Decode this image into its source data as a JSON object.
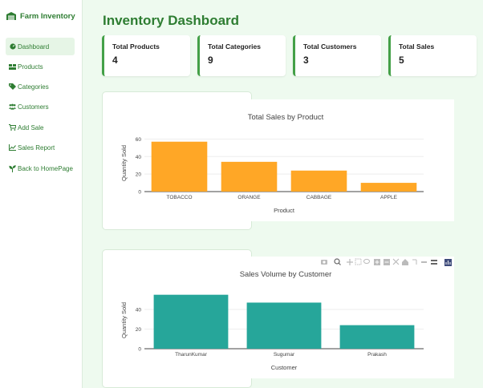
{
  "sidebar": {
    "brand": "Farm Inventory",
    "items": [
      {
        "label": "Dashboard",
        "icon": "dashboard-icon"
      },
      {
        "label": "Products",
        "icon": "products-icon"
      },
      {
        "label": "Categories",
        "icon": "tag-icon"
      },
      {
        "label": "Customers",
        "icon": "users-icon"
      },
      {
        "label": "Add Sale",
        "icon": "cart-icon"
      },
      {
        "label": "Sales Report",
        "icon": "line-chart-icon"
      },
      {
        "label": "Back to HomePage",
        "icon": "seedling-icon"
      }
    ]
  },
  "main": {
    "title": "Inventory Dashboard",
    "cards": [
      {
        "label": "Total Products",
        "value": "4"
      },
      {
        "label": "Total Categories",
        "value": "9"
      },
      {
        "label": "Total Customers",
        "value": "3"
      },
      {
        "label": "Total Sales",
        "value": "5"
      }
    ]
  },
  "colors": {
    "accent": "#2e7d32",
    "bar_product": "#ffa726",
    "bar_customer": "#26a69a"
  },
  "chart_data": [
    {
      "type": "bar",
      "title": "Total Sales by Product",
      "xlabel": "Product",
      "ylabel": "Quantity Sold",
      "categories": [
        "TOBACCO",
        "ORANGE",
        "CABBAGE",
        "APPLE"
      ],
      "values": [
        57,
        34,
        24,
        10
      ],
      "ylim": [
        0,
        65
      ],
      "yticks": [
        0,
        20,
        40,
        60
      ],
      "color": "#ffa726"
    },
    {
      "type": "bar",
      "title": "Sales Volume by Customer",
      "xlabel": "Customer",
      "ylabel": "Quantity Sold",
      "categories": [
        "TharunKumar",
        "Sugumar",
        "Prakash"
      ],
      "values": [
        55,
        47,
        24
      ],
      "ylim": [
        0,
        58
      ],
      "yticks": [
        0,
        20,
        40
      ],
      "color": "#26a69a"
    }
  ]
}
